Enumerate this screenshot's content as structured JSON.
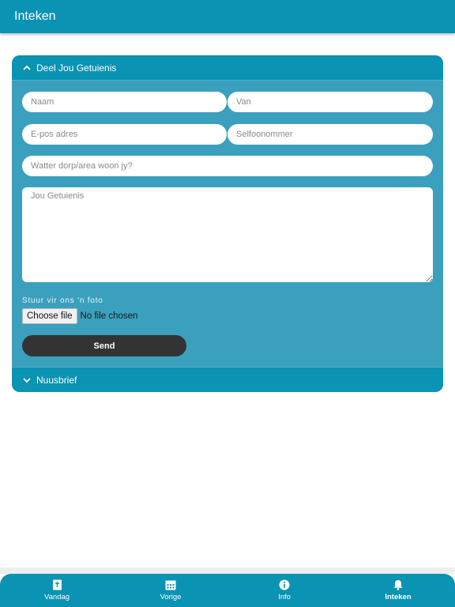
{
  "topbar": {
    "title": "Inteken"
  },
  "sections": {
    "testimony": {
      "title": "Deel Jou Getuienis",
      "fields": {
        "name": "Naam",
        "surname": "Van",
        "email": "E-pos adres",
        "phone": "Selfoonommer",
        "area": "Watter dorp/area woon jy?",
        "testimony": "Jou Getuienis"
      },
      "photo_label": "Stuur vir ons 'n foto",
      "file_button": "Choose file",
      "file_status": "No file chosen",
      "send_label": "Send"
    },
    "newsletter": {
      "title": "Nuusbrief"
    }
  },
  "bottom_nav": [
    {
      "label": "Vandag",
      "icon": "bible-icon"
    },
    {
      "label": "Vorige",
      "icon": "calendar-icon"
    },
    {
      "label": "Info",
      "icon": "info-icon"
    },
    {
      "label": "Inteken",
      "icon": "bell-icon",
      "active": true
    }
  ],
  "colors": {
    "primary": "#0a93b3",
    "panel": "#3ba0bd",
    "button": "#333333"
  }
}
